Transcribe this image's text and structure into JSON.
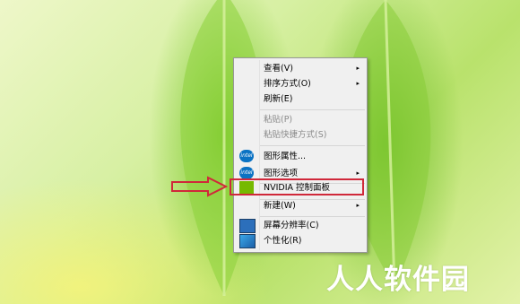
{
  "context_menu": {
    "items": [
      {
        "label": "查看(V)",
        "submenu": true,
        "disabled": false,
        "icon": ""
      },
      {
        "label": "排序方式(O)",
        "submenu": true,
        "disabled": false,
        "icon": ""
      },
      {
        "label": "刷新(E)",
        "submenu": false,
        "disabled": false,
        "icon": ""
      },
      {
        "label": "粘贴(P)",
        "submenu": false,
        "disabled": true,
        "icon": ""
      },
      {
        "label": "粘贴快捷方式(S)",
        "submenu": false,
        "disabled": true,
        "icon": ""
      },
      {
        "label": "图形属性...",
        "submenu": false,
        "disabled": false,
        "icon": "intel-icon"
      },
      {
        "label": "图形选项",
        "submenu": true,
        "disabled": false,
        "icon": "intel-icon"
      },
      {
        "label": "NVIDIA 控制面板",
        "submenu": false,
        "disabled": false,
        "icon": "nvidia-icon",
        "highlighted": true
      },
      {
        "label": "新建(W)",
        "submenu": true,
        "disabled": false,
        "icon": ""
      },
      {
        "label": "屏幕分辨率(C)",
        "submenu": false,
        "disabled": false,
        "icon": "display-icon"
      },
      {
        "label": "个性化(R)",
        "submenu": false,
        "disabled": false,
        "icon": "personalize-icon"
      }
    ],
    "submenu_glyph": "▸",
    "intel_icon_text": "intel"
  },
  "annotation": {
    "highlight_color": "#d0283a"
  },
  "watermark": {
    "text": "人人软件园"
  }
}
